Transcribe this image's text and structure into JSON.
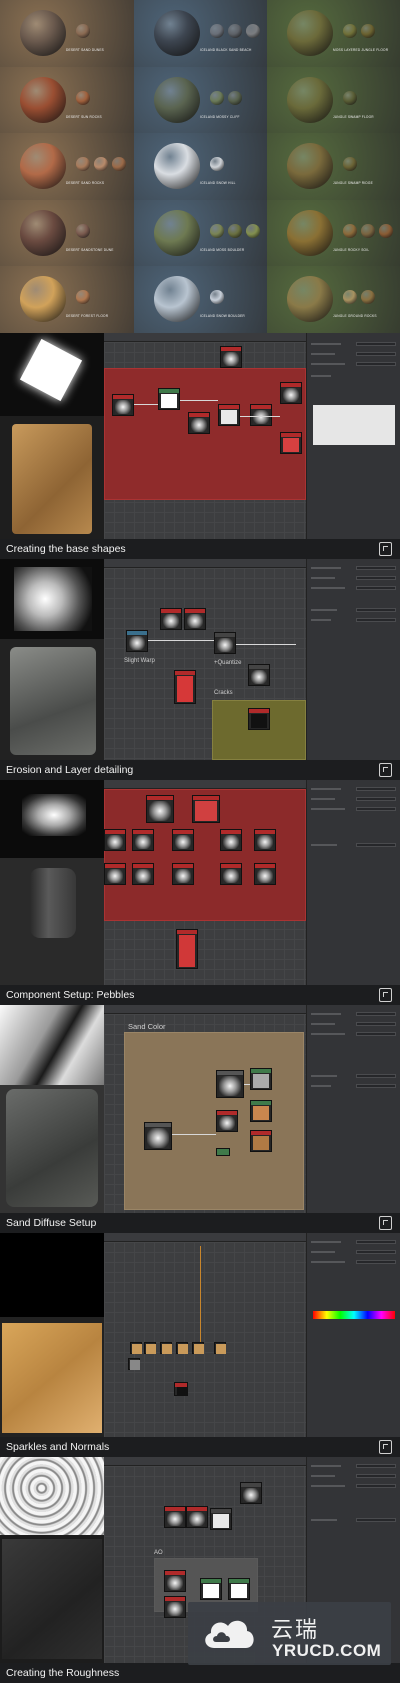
{
  "materials": [
    {
      "caption": "DESERT SAND DUNES",
      "big": "#6b5a4e",
      "small": [
        "#8a6a52"
      ]
    },
    {
      "caption": "ICELAND BLACK SAND BEACH",
      "big": "#3d4550",
      "small": [
        "#6a6f78",
        "#5e6268",
        "#7b7d80"
      ]
    },
    {
      "caption": "MOSS LAYERED JUNGLE FLOOR",
      "big": "#6c6a3a",
      "small": [
        "#707038",
        "#6b6230"
      ]
    },
    {
      "caption": "DESERT SUN ROCKS",
      "big": "#9a4e32",
      "small": [
        "#a0603c"
      ]
    },
    {
      "caption": "ICELAND MOSSY CLIFF",
      "big": "#5a6450",
      "small": [
        "#6b7a58",
        "#57614c"
      ]
    },
    {
      "caption": "JUNGLE SWAMP FLOOR",
      "big": "#6a6a3a",
      "small": [
        "#585c34"
      ]
    },
    {
      "caption": "DESERT SAND ROCKS",
      "big": "#b26a48",
      "small": [
        "#a87a5a",
        "#b88a6a",
        "#9c6a48"
      ]
    },
    {
      "caption": "ICELAND SNOW HILL",
      "big": "#d9dde2",
      "small": [
        "#cfd3d8"
      ]
    },
    {
      "caption": "JUNGLE SWAMP RIDGE",
      "big": "#7a6a3c",
      "small": [
        "#6a6234"
      ]
    },
    {
      "caption": "DESERT SANDSTONE DUNE",
      "big": "#6a4a40",
      "small": [
        "#7a5a4e"
      ]
    },
    {
      "caption": "ICELAND MOSS BOULDER",
      "big": "#6e7a52",
      "small": [
        "#7a8454",
        "#6a7040",
        "#83904e"
      ]
    },
    {
      "caption": "JUNGLE ROCKY SOIL",
      "big": "#8a7034",
      "small": [
        "#8c6a3a",
        "#7a6440",
        "#8a5c34"
      ]
    },
    {
      "caption": "DESERT FOREST FLOOR",
      "big": "#d1a25a",
      "small": [
        "#b07850"
      ]
    },
    {
      "caption": "ICELAND SNOW BOULDER",
      "big": "#b8c4d0",
      "small": [
        "#c8d0da"
      ]
    },
    {
      "caption": "JUNGLE GROUND ROCKS",
      "big": "#8a7a48",
      "small": [
        "#a89260",
        "#8a7040"
      ]
    }
  ],
  "sections": [
    {
      "title": "Creating the base shapes"
    },
    {
      "title": "Erosion and Layer detailing"
    },
    {
      "title": "Component Setup: Pebbles"
    },
    {
      "title": "Sand Diffuse Setup"
    },
    {
      "title": "Sparkles and Normals"
    },
    {
      "title": "Creating the Roughness"
    }
  ],
  "graph_labels": {
    "slight_warp": "Slight Warp",
    "quantize": "+Quantize",
    "cracks": "Cracks",
    "sand_color": "Sand Color",
    "ao": "AO"
  },
  "watermark": {
    "cn": "云瑞",
    "en": "YRUCD.COM"
  }
}
